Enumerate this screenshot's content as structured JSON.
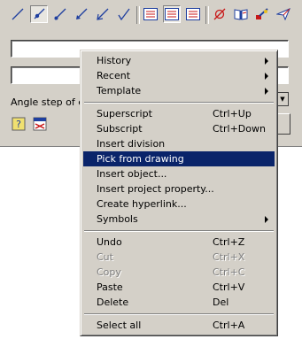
{
  "dialog": {
    "label_angle_step": "Angle step of ext",
    "field1_value": "",
    "field2_value": ""
  },
  "menu": {
    "items": [
      {
        "label": "History",
        "shortcut": "",
        "submenu": true,
        "disabled": false,
        "highlighted": false
      },
      {
        "label": "Recent",
        "shortcut": "",
        "submenu": true,
        "disabled": false,
        "highlighted": false
      },
      {
        "label": "Template",
        "shortcut": "",
        "submenu": true,
        "disabled": false,
        "highlighted": false
      },
      {
        "label": "Superscript",
        "shortcut": "Ctrl+Up",
        "submenu": false,
        "disabled": false,
        "highlighted": false
      },
      {
        "label": "Subscript",
        "shortcut": "Ctrl+Down",
        "submenu": false,
        "disabled": false,
        "highlighted": false
      },
      {
        "label": "Insert division",
        "shortcut": "",
        "submenu": false,
        "disabled": false,
        "highlighted": false
      },
      {
        "label": "Pick from drawing",
        "shortcut": "",
        "submenu": false,
        "disabled": false,
        "highlighted": true
      },
      {
        "label": "Insert object...",
        "shortcut": "",
        "submenu": false,
        "disabled": false,
        "highlighted": false
      },
      {
        "label": "Insert project property...",
        "shortcut": "",
        "submenu": false,
        "disabled": false,
        "highlighted": false
      },
      {
        "label": "Create hyperlink...",
        "shortcut": "",
        "submenu": false,
        "disabled": false,
        "highlighted": false
      },
      {
        "label": "Symbols",
        "shortcut": "",
        "submenu": true,
        "disabled": false,
        "highlighted": false
      },
      {
        "label": "Undo",
        "shortcut": "Ctrl+Z",
        "submenu": false,
        "disabled": false,
        "highlighted": false
      },
      {
        "label": "Cut",
        "shortcut": "Ctrl+X",
        "submenu": false,
        "disabled": true,
        "highlighted": false
      },
      {
        "label": "Copy",
        "shortcut": "Ctrl+C",
        "submenu": false,
        "disabled": true,
        "highlighted": false
      },
      {
        "label": "Paste",
        "shortcut": "Ctrl+V",
        "submenu": false,
        "disabled": false,
        "highlighted": false
      },
      {
        "label": "Delete",
        "shortcut": "Del",
        "submenu": false,
        "disabled": false,
        "highlighted": false
      },
      {
        "label": "Select all",
        "shortcut": "Ctrl+A",
        "submenu": false,
        "disabled": false,
        "highlighted": false
      }
    ]
  },
  "colors": {
    "face": "#d4d0c8",
    "highlight": "#0a246a",
    "icon_blue": "#1f3f9f",
    "icon_red": "#c81818"
  }
}
